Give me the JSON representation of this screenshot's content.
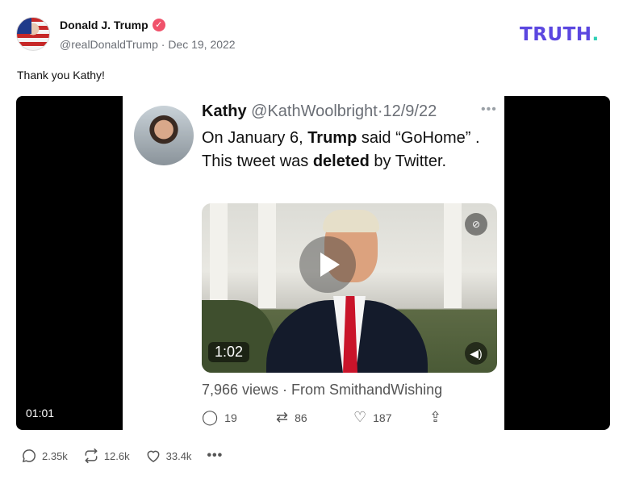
{
  "author": {
    "name": "Donald J. Trump",
    "handle": "@realDonaldTrump",
    "separator": "·",
    "date": "Dec 19, 2022",
    "verified_icon": "verified-badge-icon"
  },
  "brand": {
    "logo_text": "TRUTH",
    "logo_dot": ".",
    "colors": {
      "logo": "#5b47e0",
      "dot": "#2fd0b5"
    }
  },
  "post": {
    "text": "Thank you Kathy!"
  },
  "media": {
    "elapsed_time": "01:01",
    "embedded_tweet": {
      "name": "Kathy",
      "handle": "@KathWoolbright",
      "date": "12/9/22",
      "separator": "·",
      "more_icon": "more-horizontal-icon",
      "text_part1": "On January 6, ",
      "text_bold1": "Trump",
      "text_part2": " said “GoHome” . This tweet was ",
      "text_bold2": "deleted",
      "text_part3": " by Twitter.",
      "video_duration": "1:02",
      "views": "7,966 views · From SmithandWishing",
      "replies": "19",
      "retweets": "86",
      "likes": "187"
    }
  },
  "actions": {
    "replies": "2.35k",
    "retruths": "12.6k",
    "likes": "33.4k",
    "more": "•••"
  }
}
